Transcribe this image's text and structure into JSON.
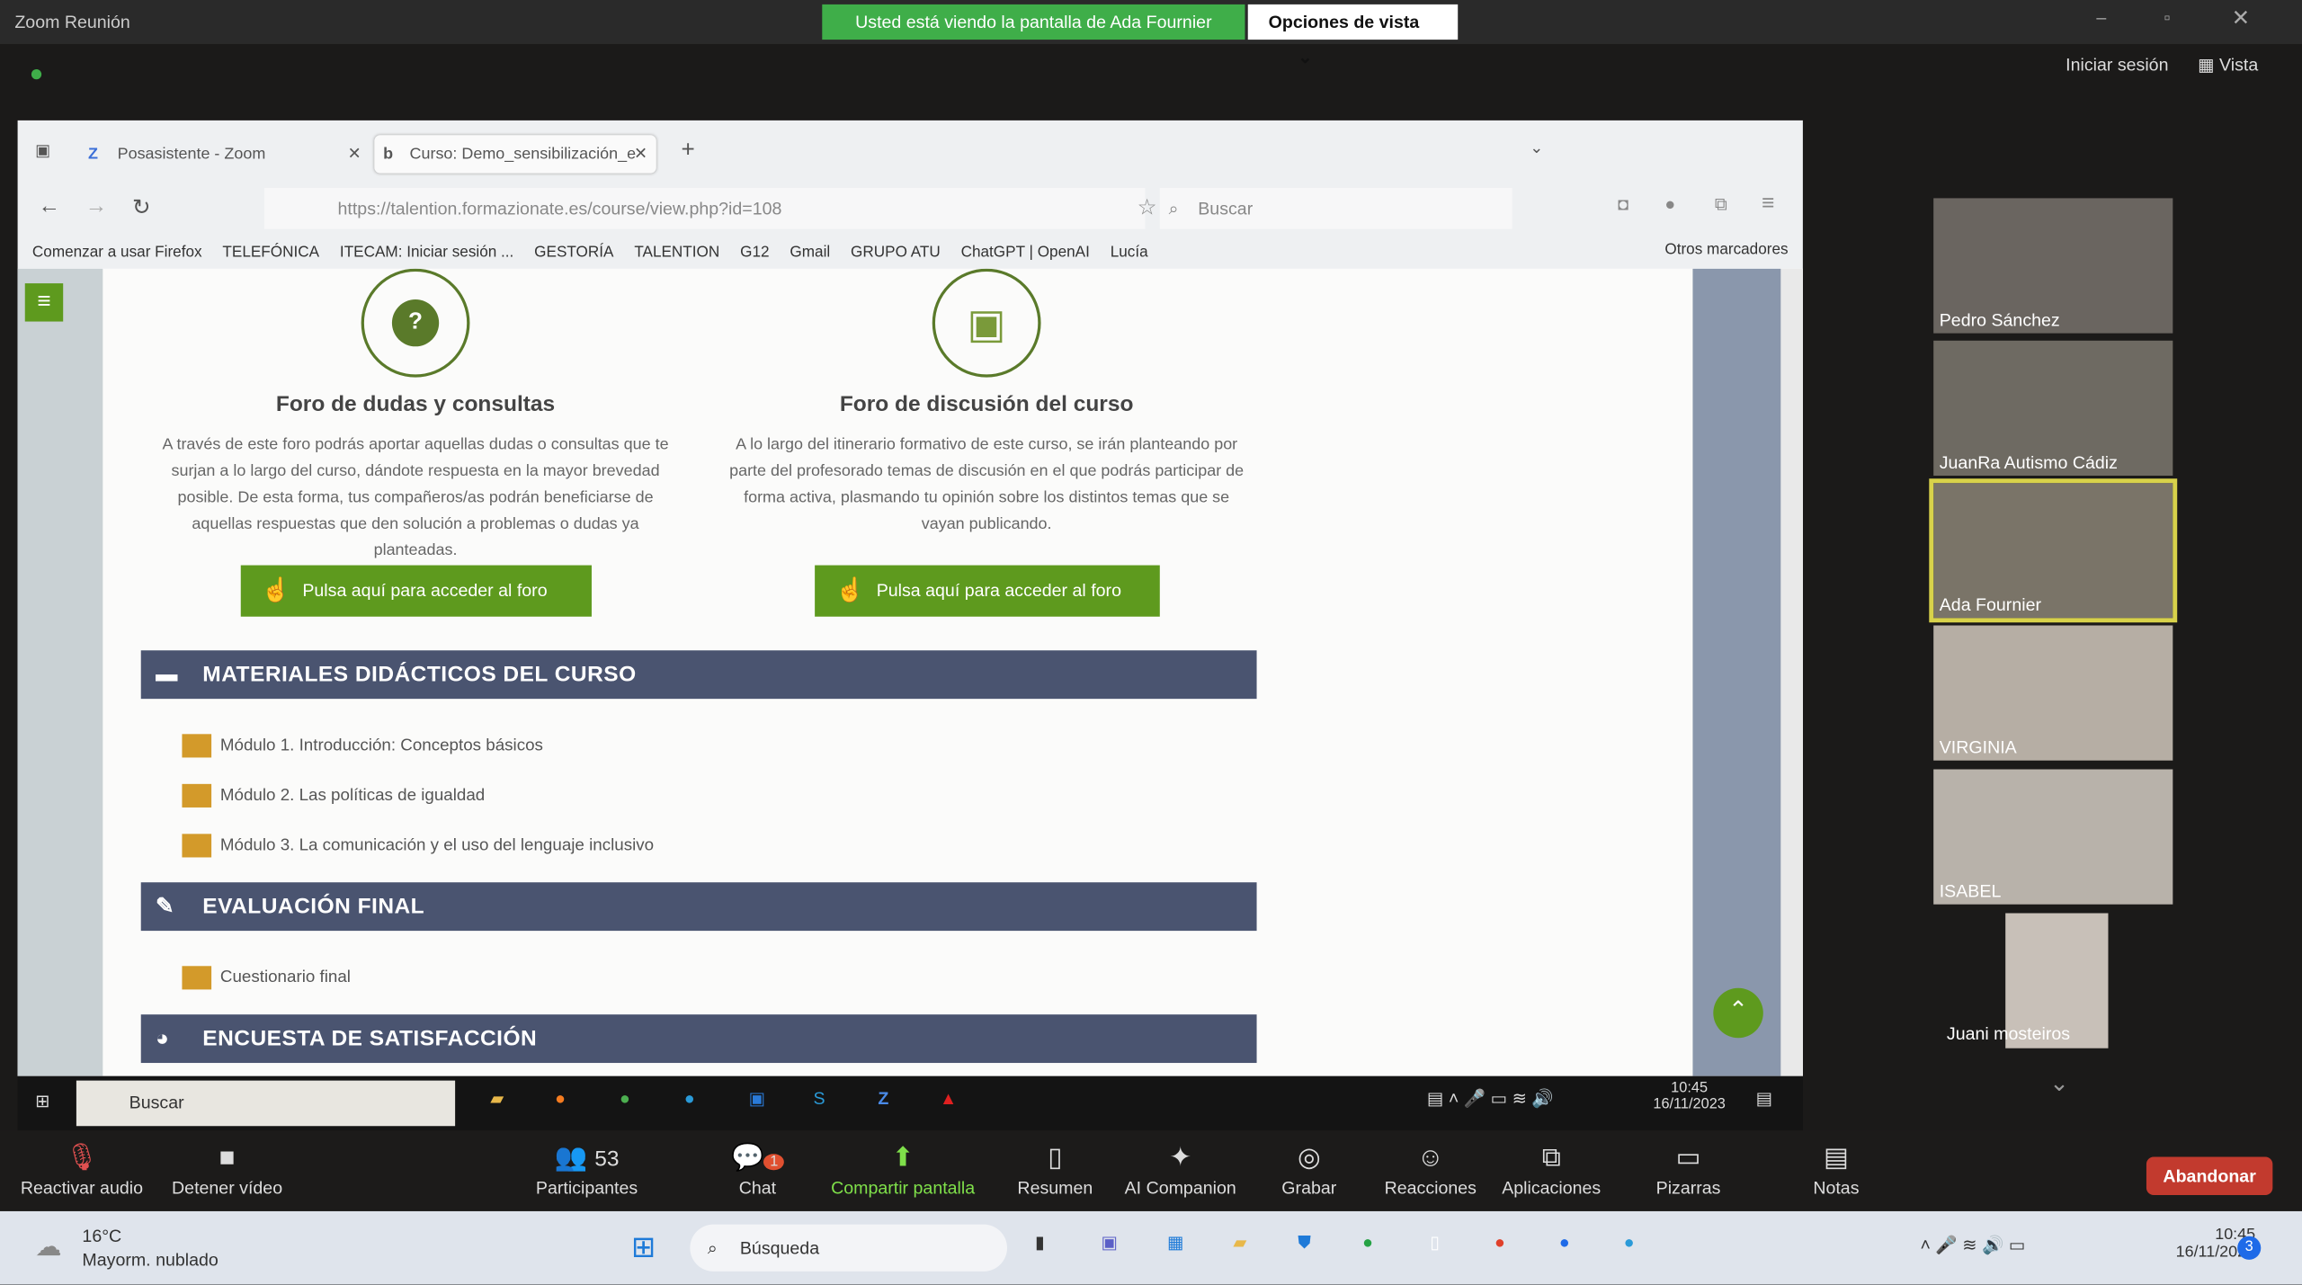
{
  "zoom": {
    "window_title": "Zoom Reunión",
    "banner": "Usted está viendo la pantalla de Ada Fournier",
    "view_options": "Opciones de vista",
    "sign_in": "Iniciar sesión",
    "view": "Vista"
  },
  "browser": {
    "tabs": [
      {
        "label": "Posasistente - Zoom"
      },
      {
        "label": "Curso: Demo_sensibilización_e"
      }
    ],
    "url": "https://talention.formazionate.es/course/view.php?id=108",
    "search_placeholder": "Buscar",
    "bookmarks": [
      "Comenzar a usar Firefox",
      "TELEFÓNICA",
      "ITECAM: Iniciar sesión ...",
      "GESTORÍA",
      "TALENTION",
      "G12",
      "Gmail",
      "GRUPO ATU",
      "ChatGPT | OpenAI",
      "Lucía"
    ],
    "other_bookmarks": "Otros marcadores"
  },
  "page": {
    "forum1": {
      "title": "Foro de dudas y consultas",
      "text": "A través de este foro podrás aportar aquellas dudas o consultas que te surjan a lo largo del curso, dándote respuesta en la mayor brevedad posible. De esta forma, tus compañeros/as podrán beneficiarse de aquellas respuestas que den solución a problemas o dudas ya planteadas.",
      "button": "Pulsa aquí para acceder al foro"
    },
    "forum2": {
      "title": "Foro de discusión del curso",
      "text": "A lo largo del itinerario formativo de este curso, se irán planteando por parte del profesorado temas de discusión en el que podrás participar de forma activa, plasmando tu opinión sobre los distintos temas que se vayan publicando.",
      "button": "Pulsa aquí para acceder al foro"
    },
    "sections": [
      {
        "title": "MATERIALES DIDÁCTICOS DEL CURSO",
        "items": [
          "Módulo 1. Introducción: Conceptos básicos",
          "Módulo 2. Las políticas de igualdad",
          "Módulo 3. La comunicación y el uso del lenguaje inclusivo"
        ]
      },
      {
        "title": "EVALUACIÓN FINAL",
        "items": [
          "Cuestionario final"
        ]
      },
      {
        "title": "ENCUESTA DE SATISFACCIÓN",
        "items": []
      }
    ]
  },
  "shared_taskbar": {
    "search": "Buscar",
    "time": "10:45",
    "date": "16/11/2023"
  },
  "toolbar": {
    "audio": "Reactivar audio",
    "video": "Detener vídeo",
    "participants": "Participantes",
    "participants_count": "53",
    "chat": "Chat",
    "chat_badge": "1",
    "share": "Compartir pantalla",
    "summary": "Resumen",
    "companion": "AI Companion",
    "record": "Grabar",
    "reactions": "Reacciones",
    "apps": "Aplicaciones",
    "whiteboards": "Pizarras",
    "notes": "Notas",
    "leave": "Abandonar"
  },
  "participants": [
    "Pedro Sánchez",
    "JuanRa Autismo Cádiz",
    "Ada Fournier",
    "VIRGINIA",
    "ISABEL",
    "Juani mosteiros"
  ],
  "os_taskbar": {
    "temp": "16°C",
    "weather": "Mayorm. nublado",
    "search": "Búsqueda",
    "time": "10:45",
    "date": "16/11/2023",
    "notif": "3"
  }
}
